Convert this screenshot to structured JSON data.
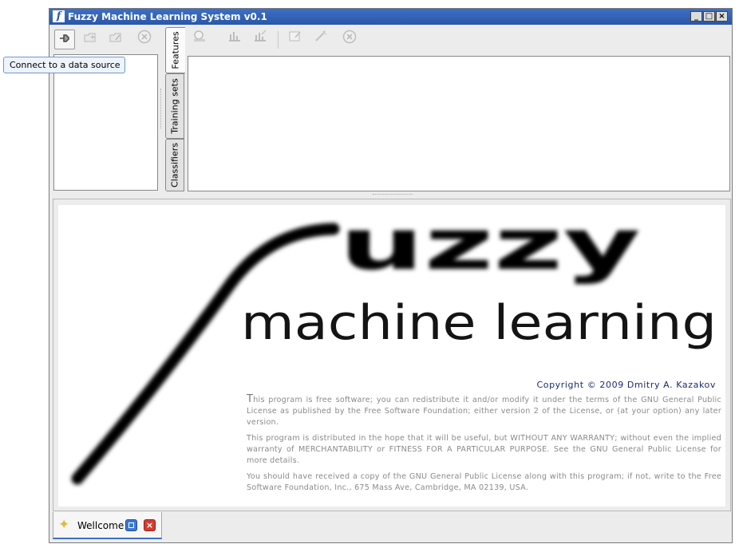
{
  "window": {
    "title": "Fuzzy Machine Learning System v0.1",
    "controls": [
      "_",
      "□",
      "×"
    ]
  },
  "left_toolbar": {
    "buttons": [
      {
        "name": "connect-button",
        "icon": "plug-icon",
        "enabled": true
      },
      {
        "name": "new-button",
        "icon": "new-folder-icon",
        "enabled": false
      },
      {
        "name": "edit-button",
        "icon": "edit-folder-icon",
        "enabled": false
      },
      {
        "name": "remove-button",
        "icon": "remove-icon",
        "enabled": false
      }
    ]
  },
  "tooltip": {
    "text": "Connect to a data source"
  },
  "side_tabs": [
    {
      "label": "Features",
      "selected": true
    },
    {
      "label": "Training sets",
      "selected": false
    },
    {
      "label": "Classifiers",
      "selected": false
    }
  ],
  "right_toolbar": {
    "buttons": [
      {
        "icon": "search-icon"
      },
      {
        "icon": "chart-add-icon"
      },
      {
        "icon": "chart-edit-icon"
      },
      {
        "icon": "document-icon"
      },
      {
        "icon": "wand-icon"
      },
      {
        "icon": "remove-icon"
      }
    ]
  },
  "splash": {
    "logo_big": "uzzy",
    "logo_sub": "machine learning",
    "copyright": "Copyright © 2009  Dmitry A. Kazakov",
    "license_p1_first": "T",
    "license_p1_rest": "his program is free software; you can redistribute it and/or modify  it under the terms of the GNU General Public License as published by  the Free Software Foundation; either version 2 of the License, or (at your option) any later version.",
    "license_p2": "This program is distributed in the hope that it will be useful, but WITHOUT ANY WARRANTY; without even the implied warranty of MERCHANTABILITY or FITNESS FOR A PARTICULAR PURPOSE. See the GNU General Public License for more details.",
    "license_p3": "You should have received a copy of the GNU General Public License along with this program; if not, write to the Free Software Foundation, Inc., 675 Mass Ave, Cambridge, MA 02139, USA."
  },
  "bottom_tabs": [
    {
      "label": "Wellcome",
      "icon": "star-icon"
    }
  ],
  "colors": {
    "titlebar": "#2a57a8",
    "tooltip_border": "#6f97cf",
    "copyright_text": "#1b2b6e",
    "tab_accent": "#3c6fc2"
  }
}
